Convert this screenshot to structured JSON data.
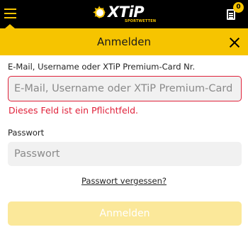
{
  "header": {
    "brand": "XTiP",
    "brand_sub": "SPORTWETTEN",
    "betslip_count": "0"
  },
  "dialog": {
    "title": "Anmelden"
  },
  "form": {
    "email_label": "E-Mail, Username oder XTiP Premium-Card Nr.",
    "email_placeholder": "E-Mail, Username oder XTiP Premium-Card Nr.",
    "email_error": "Dieses Feld ist ein Pflichtfeld.",
    "password_label": "Passwort",
    "password_placeholder": "Passwort",
    "forgot_password": "Passwort vergessen?",
    "submit_label": "Anmelden"
  },
  "colors": {
    "brand_yellow": "#f6c400",
    "header_bg": "#000000",
    "error_red": "#e0213a",
    "submit_disabled_bg": "#fbe89a"
  },
  "icons": [
    "hamburger-menu-icon",
    "xtip-logo",
    "betslip-icon",
    "close-icon"
  ]
}
